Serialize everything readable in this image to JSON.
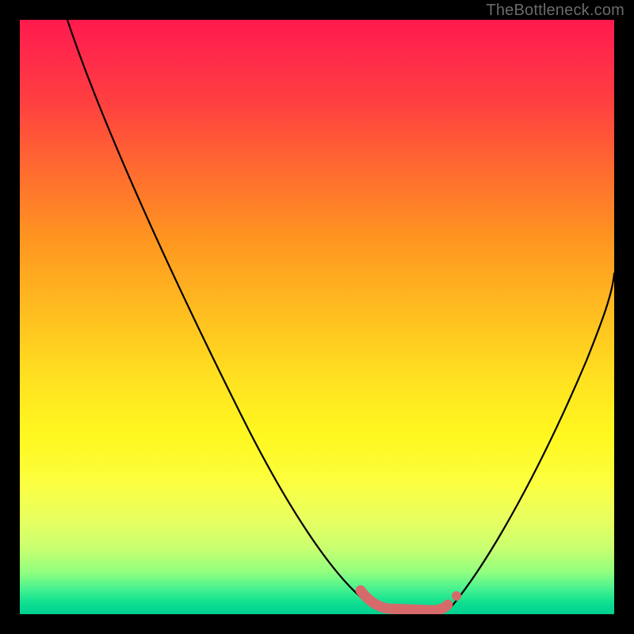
{
  "watermark": "TheBottleneck.com",
  "chart_data": {
    "type": "line",
    "title": "",
    "xlabel": "",
    "ylabel": "",
    "xlim": [
      0,
      100
    ],
    "ylim": [
      0,
      100
    ],
    "grid": false,
    "legend": false,
    "background_gradient": [
      "#ff1a4d",
      "#ff4040",
      "#ff9620",
      "#ffe020",
      "#fbff40",
      "#90ff80",
      "#00d090"
    ],
    "series": [
      {
        "name": "left-descending-curve",
        "color": "#000000",
        "x": [
          8,
          12,
          18,
          24,
          32,
          40,
          48,
          55,
          58,
          60
        ],
        "y": [
          100,
          92,
          80,
          68,
          52,
          36,
          20,
          8,
          3,
          1
        ]
      },
      {
        "name": "right-ascending-curve",
        "color": "#000000",
        "x": [
          72,
          76,
          82,
          88,
          94,
          100
        ],
        "y": [
          1,
          6,
          18,
          32,
          46,
          58
        ]
      },
      {
        "name": "valley-floor-highlight",
        "color": "#d46a6a",
        "marker": true,
        "x": [
          57,
          60,
          63,
          66,
          69,
          72,
          73
        ],
        "y": [
          3,
          1,
          0.5,
          0.5,
          0.7,
          2,
          3
        ]
      }
    ],
    "annotations": []
  }
}
